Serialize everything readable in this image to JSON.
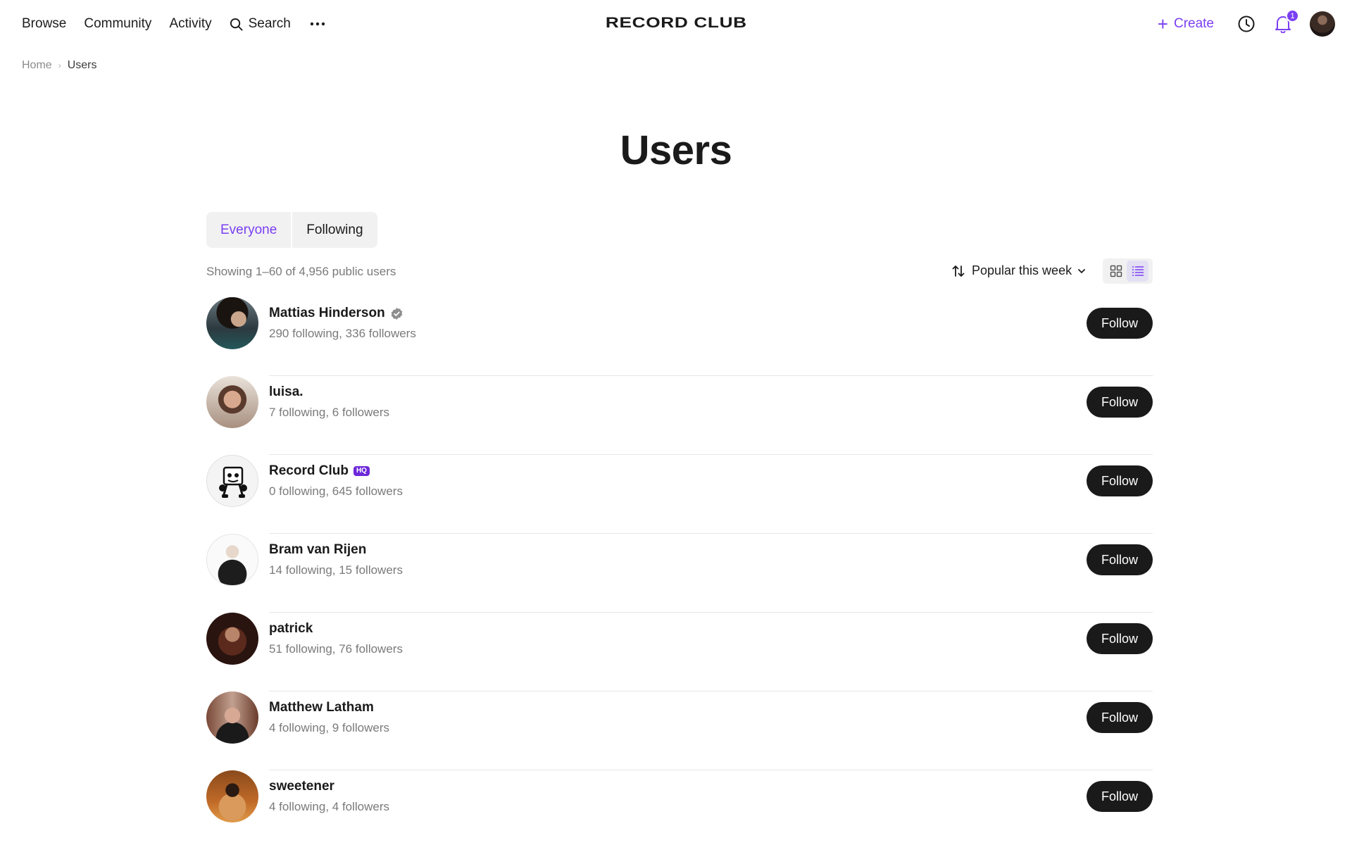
{
  "nav": {
    "links": [
      "Browse",
      "Community",
      "Activity"
    ],
    "search_label": "Search",
    "logo": "RECORD CLUB",
    "create_label": "Create",
    "notification_count": "1"
  },
  "breadcrumb": {
    "home": "Home",
    "current": "Users"
  },
  "page": {
    "title": "Users"
  },
  "tabs": [
    {
      "label": "Everyone",
      "active": true
    },
    {
      "label": "Following",
      "active": false
    }
  ],
  "toolbar": {
    "count_text": "Showing 1–60 of 4,956 public users",
    "sort_label": "Popular this week",
    "view_mode": "list"
  },
  "users": [
    {
      "name": "Mattias Hinderson",
      "stats": "290 following, 336 followers",
      "verified": true,
      "badge": "",
      "follow_label": "Follow"
    },
    {
      "name": "luisa.",
      "stats": "7 following, 6 followers",
      "verified": false,
      "badge": "",
      "follow_label": "Follow"
    },
    {
      "name": "Record Club",
      "stats": "0 following, 645 followers",
      "verified": false,
      "badge": "HQ",
      "follow_label": "Follow"
    },
    {
      "name": "Bram van Rijen",
      "stats": "14 following, 15 followers",
      "verified": false,
      "badge": "",
      "follow_label": "Follow"
    },
    {
      "name": "patrick",
      "stats": "51 following, 76 followers",
      "verified": false,
      "badge": "",
      "follow_label": "Follow"
    },
    {
      "name": "Matthew Latham",
      "stats": "4 following, 9 followers",
      "verified": false,
      "badge": "",
      "follow_label": "Follow"
    },
    {
      "name": "sweetener",
      "stats": "4 following, 4 followers",
      "verified": false,
      "badge": "",
      "follow_label": "Follow"
    }
  ],
  "colors": {
    "accent": "#7b3ff2",
    "follow_button": "#1a1a1a",
    "muted_text": "#7a7a7a"
  },
  "icons": {
    "search": "search-icon",
    "more": "more-icon",
    "history": "clock-icon",
    "notifications": "bell-icon",
    "sort": "sort-icon",
    "grid_view": "grid-view-icon",
    "list_view": "list-view-icon",
    "verified": "verified-icon"
  }
}
